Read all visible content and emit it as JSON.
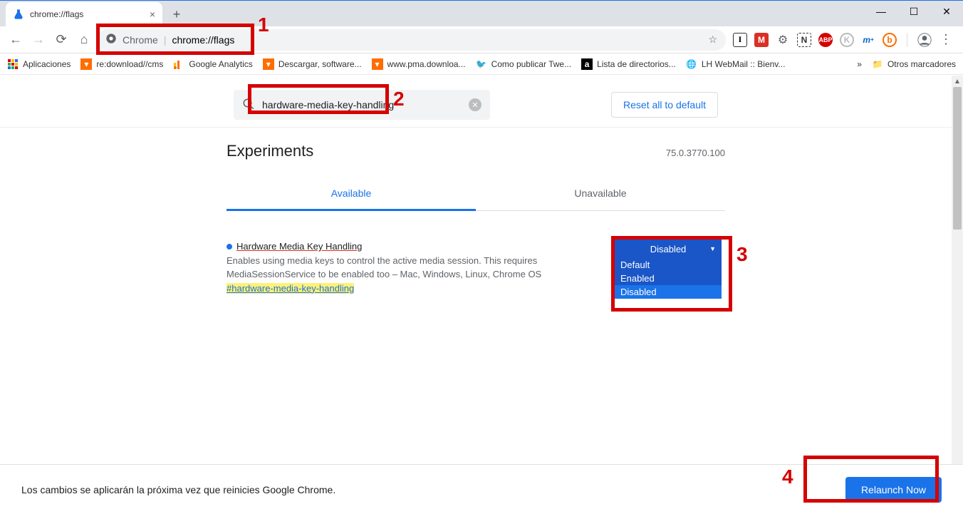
{
  "window": {
    "tab_title": "chrome://flags"
  },
  "omnibox": {
    "scheme_label": "Chrome",
    "url_text": "chrome://flags"
  },
  "bookmarks": {
    "apps": "Aplicaciones",
    "items": [
      "re:download//cms",
      "Google Analytics",
      "Descargar, software...",
      "www.pma.downloa...",
      "Como publicar Twe...",
      "Lista de directorios...",
      "LH WebMail :: Bienv..."
    ],
    "overflow": "»",
    "other": "Otros marcadores"
  },
  "flags": {
    "search_value": "hardware-media-key-handling",
    "reset_label": "Reset all to default",
    "heading": "Experiments",
    "version": "75.0.3770.100",
    "tab_available": "Available",
    "tab_unavailable": "Unavailable",
    "item": {
      "title": "Hardware Media Key Handling",
      "desc": "Enables using media keys to control the active media session. This requires MediaSessionService to be enabled too – Mac, Windows, Linux, Chrome OS",
      "anchor": "#hardware-media-key-handling",
      "selected": "Disabled",
      "options": [
        "Default",
        "Enabled",
        "Disabled"
      ]
    }
  },
  "footer": {
    "msg": "Los cambios se aplicarán la próxima vez que reinicies Google Chrome.",
    "relaunch": "Relaunch Now"
  },
  "annotations": {
    "n1": "1",
    "n2": "2",
    "n3": "3",
    "n4": "4"
  }
}
